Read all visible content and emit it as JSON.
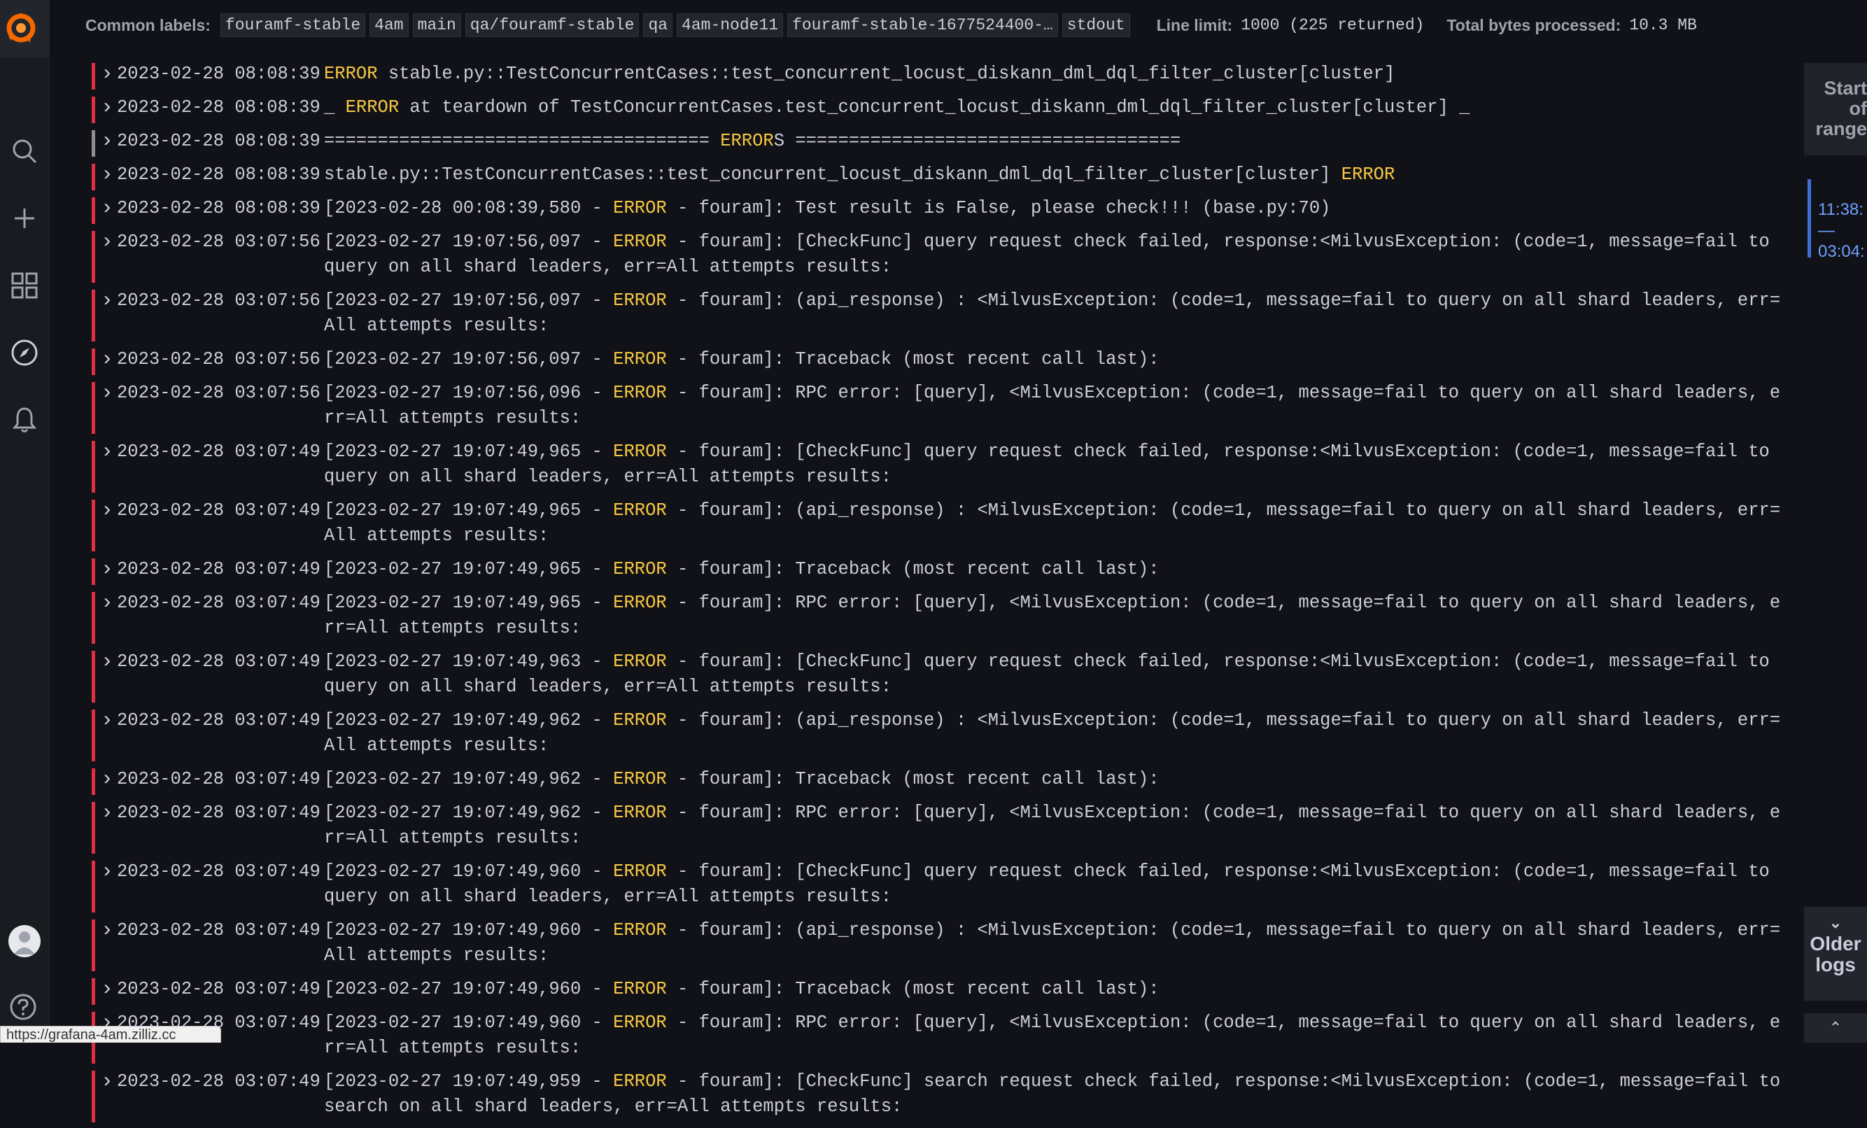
{
  "header": {
    "common_labels_title": "Common labels:",
    "labels": [
      "fouramf-stable",
      "4am",
      "main",
      "qa/fouramf-stable",
      "qa",
      "4am-node11",
      "fouramf-stable-1677524400-…",
      "stdout"
    ],
    "line_limit_title": "Line limit:",
    "line_limit_value": "1000 (225 returned)",
    "bytes_title": "Total bytes processed:",
    "bytes_value": "10.3 MB"
  },
  "logs": [
    {
      "ts": "2023-02-28 08:08:39",
      "pre": "",
      "level": "ERROR",
      "post": " stable.py::TestConcurrentCases::test_concurrent_locust_diskann_dml_dql_filter_cluster[cluster]",
      "bar": "red"
    },
    {
      "ts": "2023-02-28 08:08:39",
      "pre": "_ ",
      "level": "ERROR",
      "post": " at teardown of TestConcurrentCases.test_concurrent_locust_diskann_dml_dql_filter_cluster[cluster] _",
      "bar": "red"
    },
    {
      "ts": "2023-02-28 08:08:39",
      "pre": "==================================== ",
      "level": "ERROR",
      "post": "S ====================================",
      "bar": "grey"
    },
    {
      "ts": "2023-02-28 08:08:39",
      "pre": "stable.py::TestConcurrentCases::test_concurrent_locust_diskann_dml_dql_filter_cluster[cluster] ",
      "level": "ERROR",
      "post": "",
      "bar": "red"
    },
    {
      "ts": "2023-02-28 08:08:39",
      "pre": "[2023-02-28 00:08:39,580 - ",
      "level": "ERROR",
      "post": " - fouram]: Test result is False, please check!!! (base.py:70)",
      "bar": "red"
    },
    {
      "ts": "2023-02-28 03:07:56",
      "pre": "[2023-02-27 19:07:56,097 - ",
      "level": "ERROR",
      "post": " - fouram]: [CheckFunc] query request check failed, response:<MilvusException: (code=1, message=fail to query on all shard leaders, err=All attempts results:",
      "bar": "red"
    },
    {
      "ts": "2023-02-28 03:07:56",
      "pre": "[2023-02-27 19:07:56,097 - ",
      "level": "ERROR",
      "post": " - fouram]: (api_response) : <MilvusException: (code=1, message=fail to query on all shard leaders, err=All attempts results:",
      "bar": "red"
    },
    {
      "ts": "2023-02-28 03:07:56",
      "pre": "[2023-02-27 19:07:56,097 - ",
      "level": "ERROR",
      "post": " - fouram]: Traceback (most recent call last):",
      "bar": "red"
    },
    {
      "ts": "2023-02-28 03:07:56",
      "pre": "[2023-02-27 19:07:56,096 - ",
      "level": "ERROR",
      "post": " - fouram]: RPC error: [query], <MilvusException: (code=1, message=fail to query on all shard leaders, err=All attempts results:",
      "bar": "red"
    },
    {
      "ts": "2023-02-28 03:07:49",
      "pre": "[2023-02-27 19:07:49,965 - ",
      "level": "ERROR",
      "post": " - fouram]: [CheckFunc] query request check failed, response:<MilvusException: (code=1, message=fail to query on all shard leaders, err=All attempts results:",
      "bar": "red"
    },
    {
      "ts": "2023-02-28 03:07:49",
      "pre": "[2023-02-27 19:07:49,965 - ",
      "level": "ERROR",
      "post": " - fouram]: (api_response) : <MilvusException: (code=1, message=fail to query on all shard leaders, err=All attempts results:",
      "bar": "red"
    },
    {
      "ts": "2023-02-28 03:07:49",
      "pre": "[2023-02-27 19:07:49,965 - ",
      "level": "ERROR",
      "post": " - fouram]: Traceback (most recent call last):",
      "bar": "red"
    },
    {
      "ts": "2023-02-28 03:07:49",
      "pre": "[2023-02-27 19:07:49,965 - ",
      "level": "ERROR",
      "post": " - fouram]: RPC error: [query], <MilvusException: (code=1, message=fail to query on all shard leaders, err=All attempts results:",
      "bar": "red"
    },
    {
      "ts": "2023-02-28 03:07:49",
      "pre": "[2023-02-27 19:07:49,963 - ",
      "level": "ERROR",
      "post": " - fouram]: [CheckFunc] query request check failed, response:<MilvusException: (code=1, message=fail to query on all shard leaders, err=All attempts results:",
      "bar": "red"
    },
    {
      "ts": "2023-02-28 03:07:49",
      "pre": "[2023-02-27 19:07:49,962 - ",
      "level": "ERROR",
      "post": " - fouram]: (api_response) : <MilvusException: (code=1, message=fail to query on all shard leaders, err=All attempts results:",
      "bar": "red"
    },
    {
      "ts": "2023-02-28 03:07:49",
      "pre": "[2023-02-27 19:07:49,962 - ",
      "level": "ERROR",
      "post": " - fouram]: Traceback (most recent call last):",
      "bar": "red"
    },
    {
      "ts": "2023-02-28 03:07:49",
      "pre": "[2023-02-27 19:07:49,962 - ",
      "level": "ERROR",
      "post": " - fouram]: RPC error: [query], <MilvusException: (code=1, message=fail to query on all shard leaders, err=All attempts results:",
      "bar": "red"
    },
    {
      "ts": "2023-02-28 03:07:49",
      "pre": "[2023-02-27 19:07:49,960 - ",
      "level": "ERROR",
      "post": " - fouram]: [CheckFunc] query request check failed, response:<MilvusException: (code=1, message=fail to query on all shard leaders, err=All attempts results:",
      "bar": "red"
    },
    {
      "ts": "2023-02-28 03:07:49",
      "pre": "[2023-02-27 19:07:49,960 - ",
      "level": "ERROR",
      "post": " - fouram]: (api_response) : <MilvusException: (code=1, message=fail to query on all shard leaders, err=All attempts results:",
      "bar": "red"
    },
    {
      "ts": "2023-02-28 03:07:49",
      "pre": "[2023-02-27 19:07:49,960 - ",
      "level": "ERROR",
      "post": " - fouram]: Traceback (most recent call last):",
      "bar": "red"
    },
    {
      "ts": "2023-02-28 03:07:49",
      "pre": "[2023-02-27 19:07:49,960 - ",
      "level": "ERROR",
      "post": " - fouram]: RPC error: [query], <MilvusException: (code=1, message=fail to query on all shard leaders, err=All attempts results:",
      "bar": "red"
    },
    {
      "ts": "2023-02-28 03:07:49",
      "pre": "[2023-02-27 19:07:49,959 - ",
      "level": "ERROR",
      "post": " - fouram]: [CheckFunc] search request check failed, response:<MilvusException: (code=1, message=fail to search on all shard leaders, err=All attempts results:",
      "bar": "red"
    }
  ],
  "right_panel": {
    "start_of_range": "Start of range",
    "range_start": "11:38:",
    "range_sep": "—",
    "range_end": "03:04:",
    "older_logs": "Older logs"
  },
  "status_url": "https://grafana-4am.zilliz.cc",
  "colors": {
    "error_text": "#f8c843",
    "error_bar": "#e02f44",
    "accent": "#3d71d9"
  }
}
